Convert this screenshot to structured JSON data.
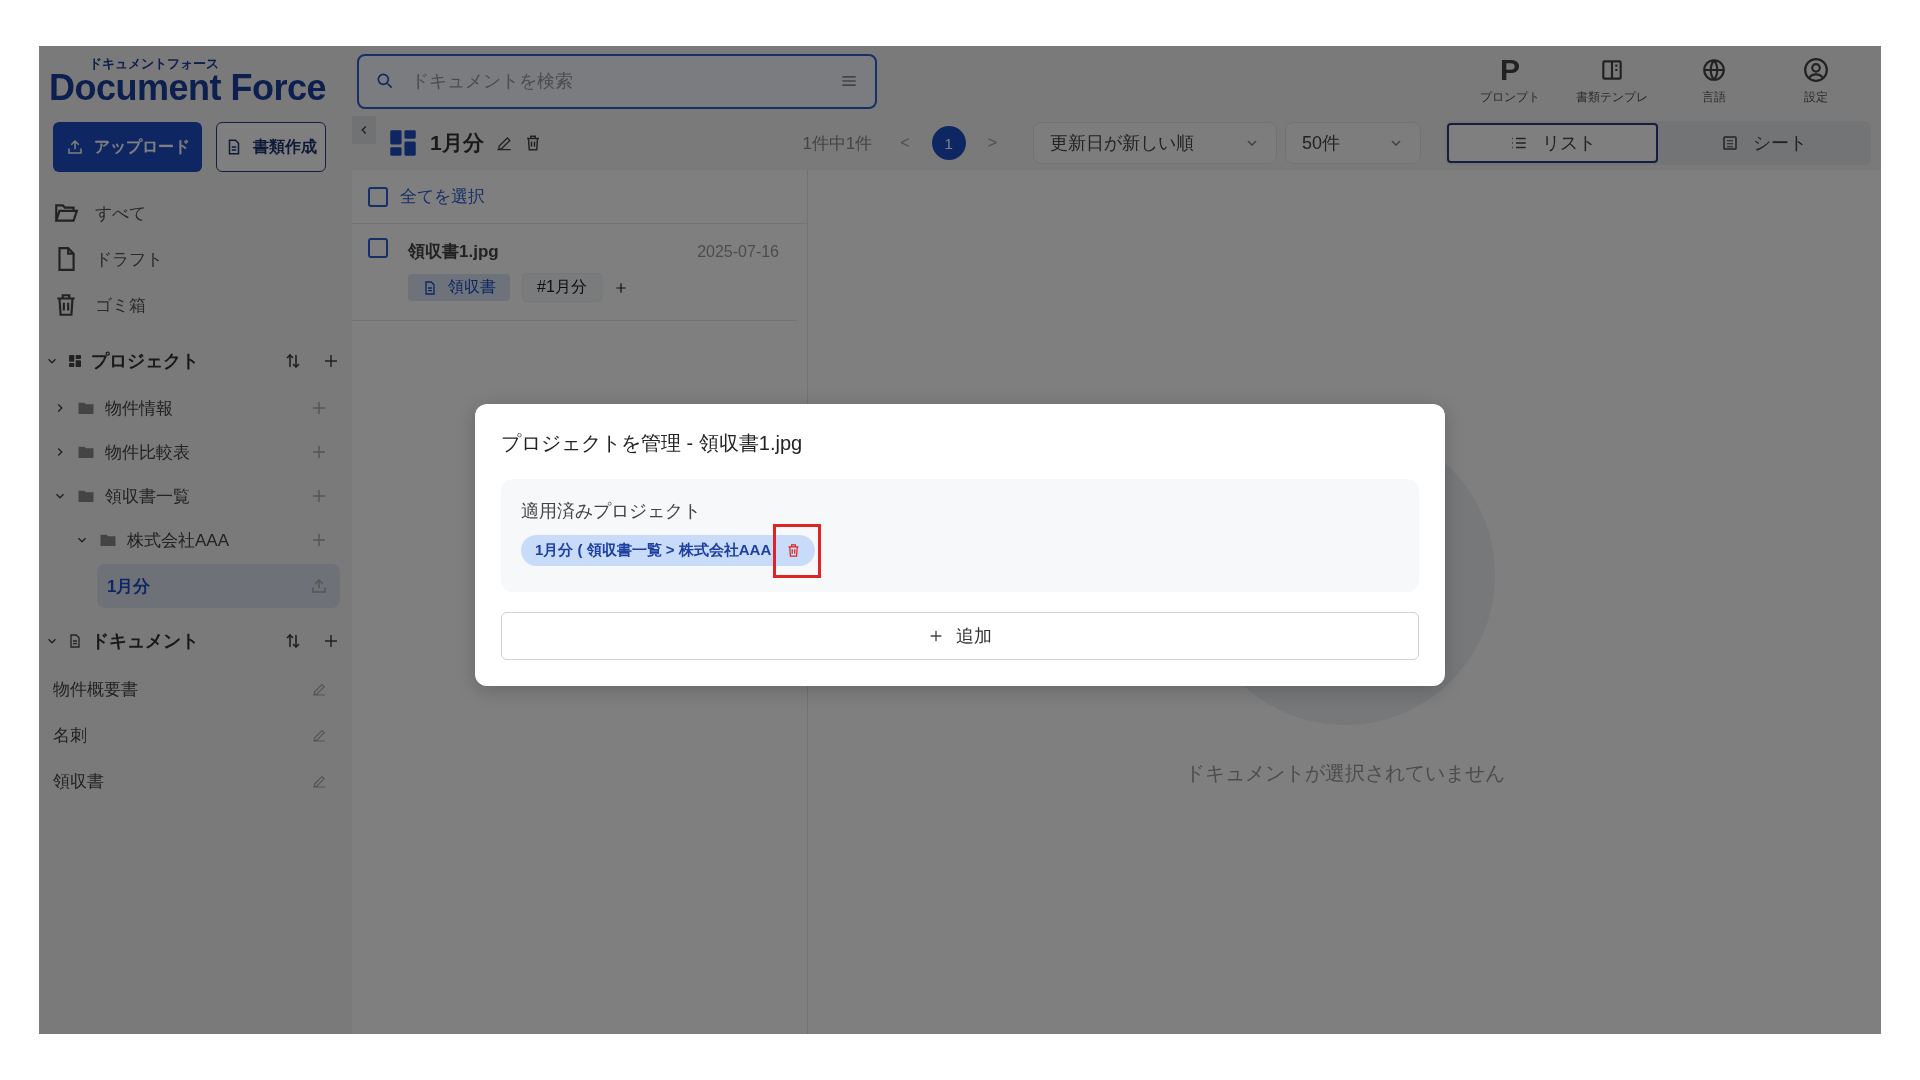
{
  "header": {
    "logo": {
      "kana": "ドキュメントフォース",
      "name": "Document Force"
    },
    "search": {
      "placeholder": "ドキュメントを検索"
    },
    "nav": [
      {
        "glyph": "P",
        "label": "プロンプト"
      },
      {
        "label": "書類テンプレ"
      },
      {
        "label": "言語"
      },
      {
        "label": "設定"
      }
    ]
  },
  "sidebar": {
    "buttons": [
      {
        "label": "アップロード",
        "primary": true
      },
      {
        "label": "書類作成",
        "primary": false
      }
    ],
    "nav": [
      {
        "label": "すべて"
      },
      {
        "label": "ドラフト"
      },
      {
        "label": "ゴミ箱"
      }
    ],
    "projects": {
      "title": "プロジェクト",
      "expanded": true,
      "items": [
        {
          "label": "物件情報",
          "expanded": false,
          "selected": false
        },
        {
          "label": "物件比較表",
          "expanded": false,
          "selected": false
        },
        {
          "label": "領収書一覧",
          "expanded": true,
          "selected": false,
          "children": [
            {
              "label": "株式会社AAA",
              "expanded": true,
              "selected": false,
              "children": [
                {
                  "label": "1月分",
                  "selected": true
                }
              ]
            }
          ]
        }
      ]
    },
    "documents": {
      "title": "ドキュメント",
      "expanded": true,
      "items": [
        {
          "label": "物件概要書"
        },
        {
          "label": "名刺"
        },
        {
          "label": "領収書"
        }
      ]
    }
  },
  "toolbar": {
    "project": "1月分",
    "count": "1件中1件",
    "prev": "<",
    "pages": [
      {
        "label": "1",
        "selected": true
      }
    ],
    "next": ">",
    "sort": "更新日が新しい順",
    "per_page": "50件",
    "views": [
      {
        "label": "リスト",
        "selected": true
      },
      {
        "label": "シート",
        "selected": false
      }
    ]
  },
  "list": {
    "select_all": {
      "label": "全てを選択",
      "checked": false
    },
    "rows": [
      {
        "name": "領収書1.jpg",
        "date": "2025-07-16",
        "checked": false,
        "type_tag": "領収書",
        "tags": [
          "#1月分"
        ]
      }
    ]
  },
  "preview": {
    "empty_message": "ドキュメントが選択されていません"
  },
  "modal": {
    "title": "プロジェクトを管理 - 領収書1.jpg",
    "section_label": "適用済みプロジェクト",
    "applied": [
      {
        "label": "1月分 ( 領収書一覧 > 株式会社AAA",
        "delete_highlighted": true
      }
    ],
    "add_button": "追加"
  }
}
